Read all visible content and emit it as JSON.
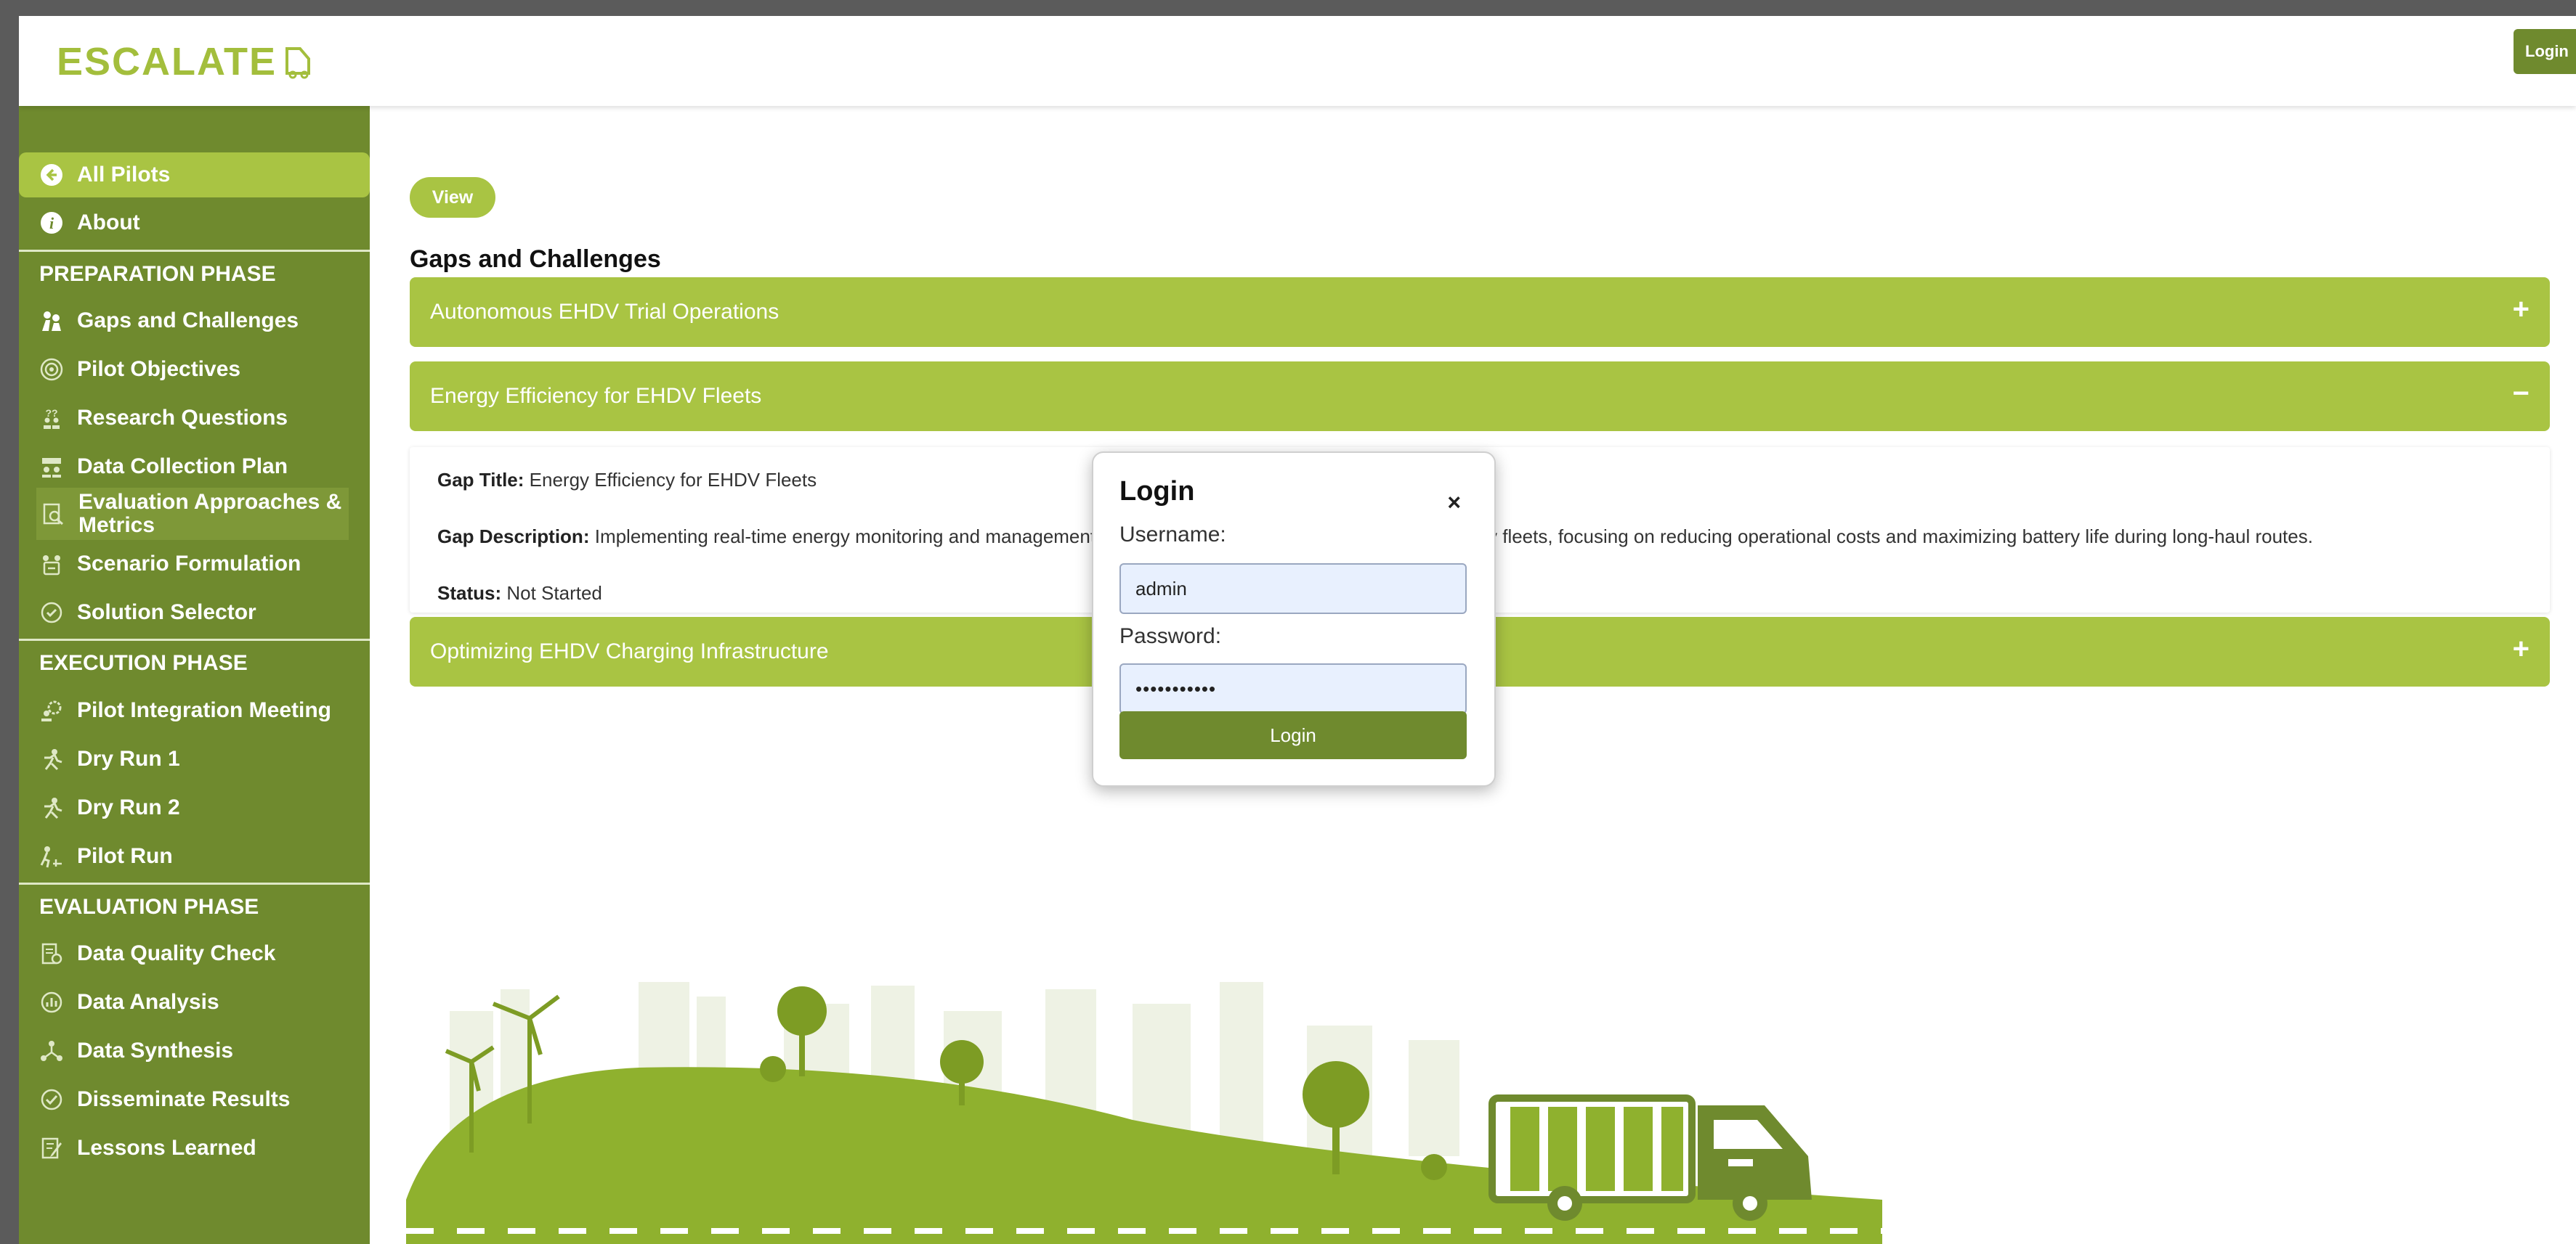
{
  "header": {
    "logo_text": "ESCALATE",
    "login_label": "Login"
  },
  "sidebar": {
    "items": [
      {
        "label": "All Pilots",
        "icon": "arrow-left-circle-icon"
      },
      {
        "label": "About",
        "icon": "info-circle-icon"
      }
    ],
    "phases": [
      {
        "title": "PREPARATION PHASE",
        "items": [
          {
            "label": "Gaps and Challenges",
            "icon": "climbing-people-icon"
          },
          {
            "label": "Pilot Objectives",
            "icon": "target-icon"
          },
          {
            "label": "Research Questions",
            "icon": "question-people-icon"
          },
          {
            "label": "Data Collection Plan",
            "icon": "data-collection-icon"
          },
          {
            "label": "Evaluation Approaches & Metrics",
            "icon": "evaluation-icon"
          },
          {
            "label": "Scenario Formulation",
            "icon": "scenario-icon"
          },
          {
            "label": "Solution Selector",
            "icon": "check-circle-icon"
          }
        ]
      },
      {
        "title": "EXECUTION PHASE",
        "items": [
          {
            "label": "Pilot Integration Meeting",
            "icon": "gear-people-icon"
          },
          {
            "label": "Dry Run 1",
            "icon": "runner-icon"
          },
          {
            "label": "Dry Run 2",
            "icon": "runner-icon"
          },
          {
            "label": "Pilot Run",
            "icon": "pilot-run-icon"
          }
        ]
      },
      {
        "title": "EVALUATION PHASE",
        "items": [
          {
            "label": "Data Quality Check",
            "icon": "document-check-icon"
          },
          {
            "label": "Data Analysis",
            "icon": "analysis-icon"
          },
          {
            "label": "Data Synthesis",
            "icon": "synthesis-icon"
          },
          {
            "label": "Disseminate Results",
            "icon": "disseminate-icon"
          },
          {
            "label": "Lessons Learned",
            "icon": "notebook-icon"
          }
        ]
      }
    ]
  },
  "main": {
    "view_label": "View",
    "section_title": "Gaps and Challenges",
    "accordion": [
      {
        "title": "Autonomous EHDV Trial Operations",
        "toggle": "+"
      },
      {
        "title": "Energy Efficiency for EHDV Fleets",
        "toggle": "−"
      },
      {
        "title": "Optimizing EHDV Charging Infrastructure",
        "toggle": "+"
      }
    ],
    "details": {
      "title_label": "Gap Title:",
      "title_value": "Energy Efficiency for EHDV Fleets",
      "description_label": "Gap Description:",
      "description_start": "Implementing real-time energy monitoring and management s",
      "description_end": "y fleets, focusing on reducing operational costs and maximizing battery life during long-haul routes.",
      "status_label": "Status:",
      "status_value": "Not Started"
    }
  },
  "modal": {
    "title": "Login",
    "close": "×",
    "username_label": "Username:",
    "username_value": "admin",
    "password_label": "Password:",
    "password_value": "•••••••••••",
    "submit_label": "Login"
  },
  "colors": {
    "sidebar": "#6f8a2e",
    "accent": "#a9c443",
    "dark_button": "#6f8a2e",
    "input_fill": "#e8f0fe"
  }
}
